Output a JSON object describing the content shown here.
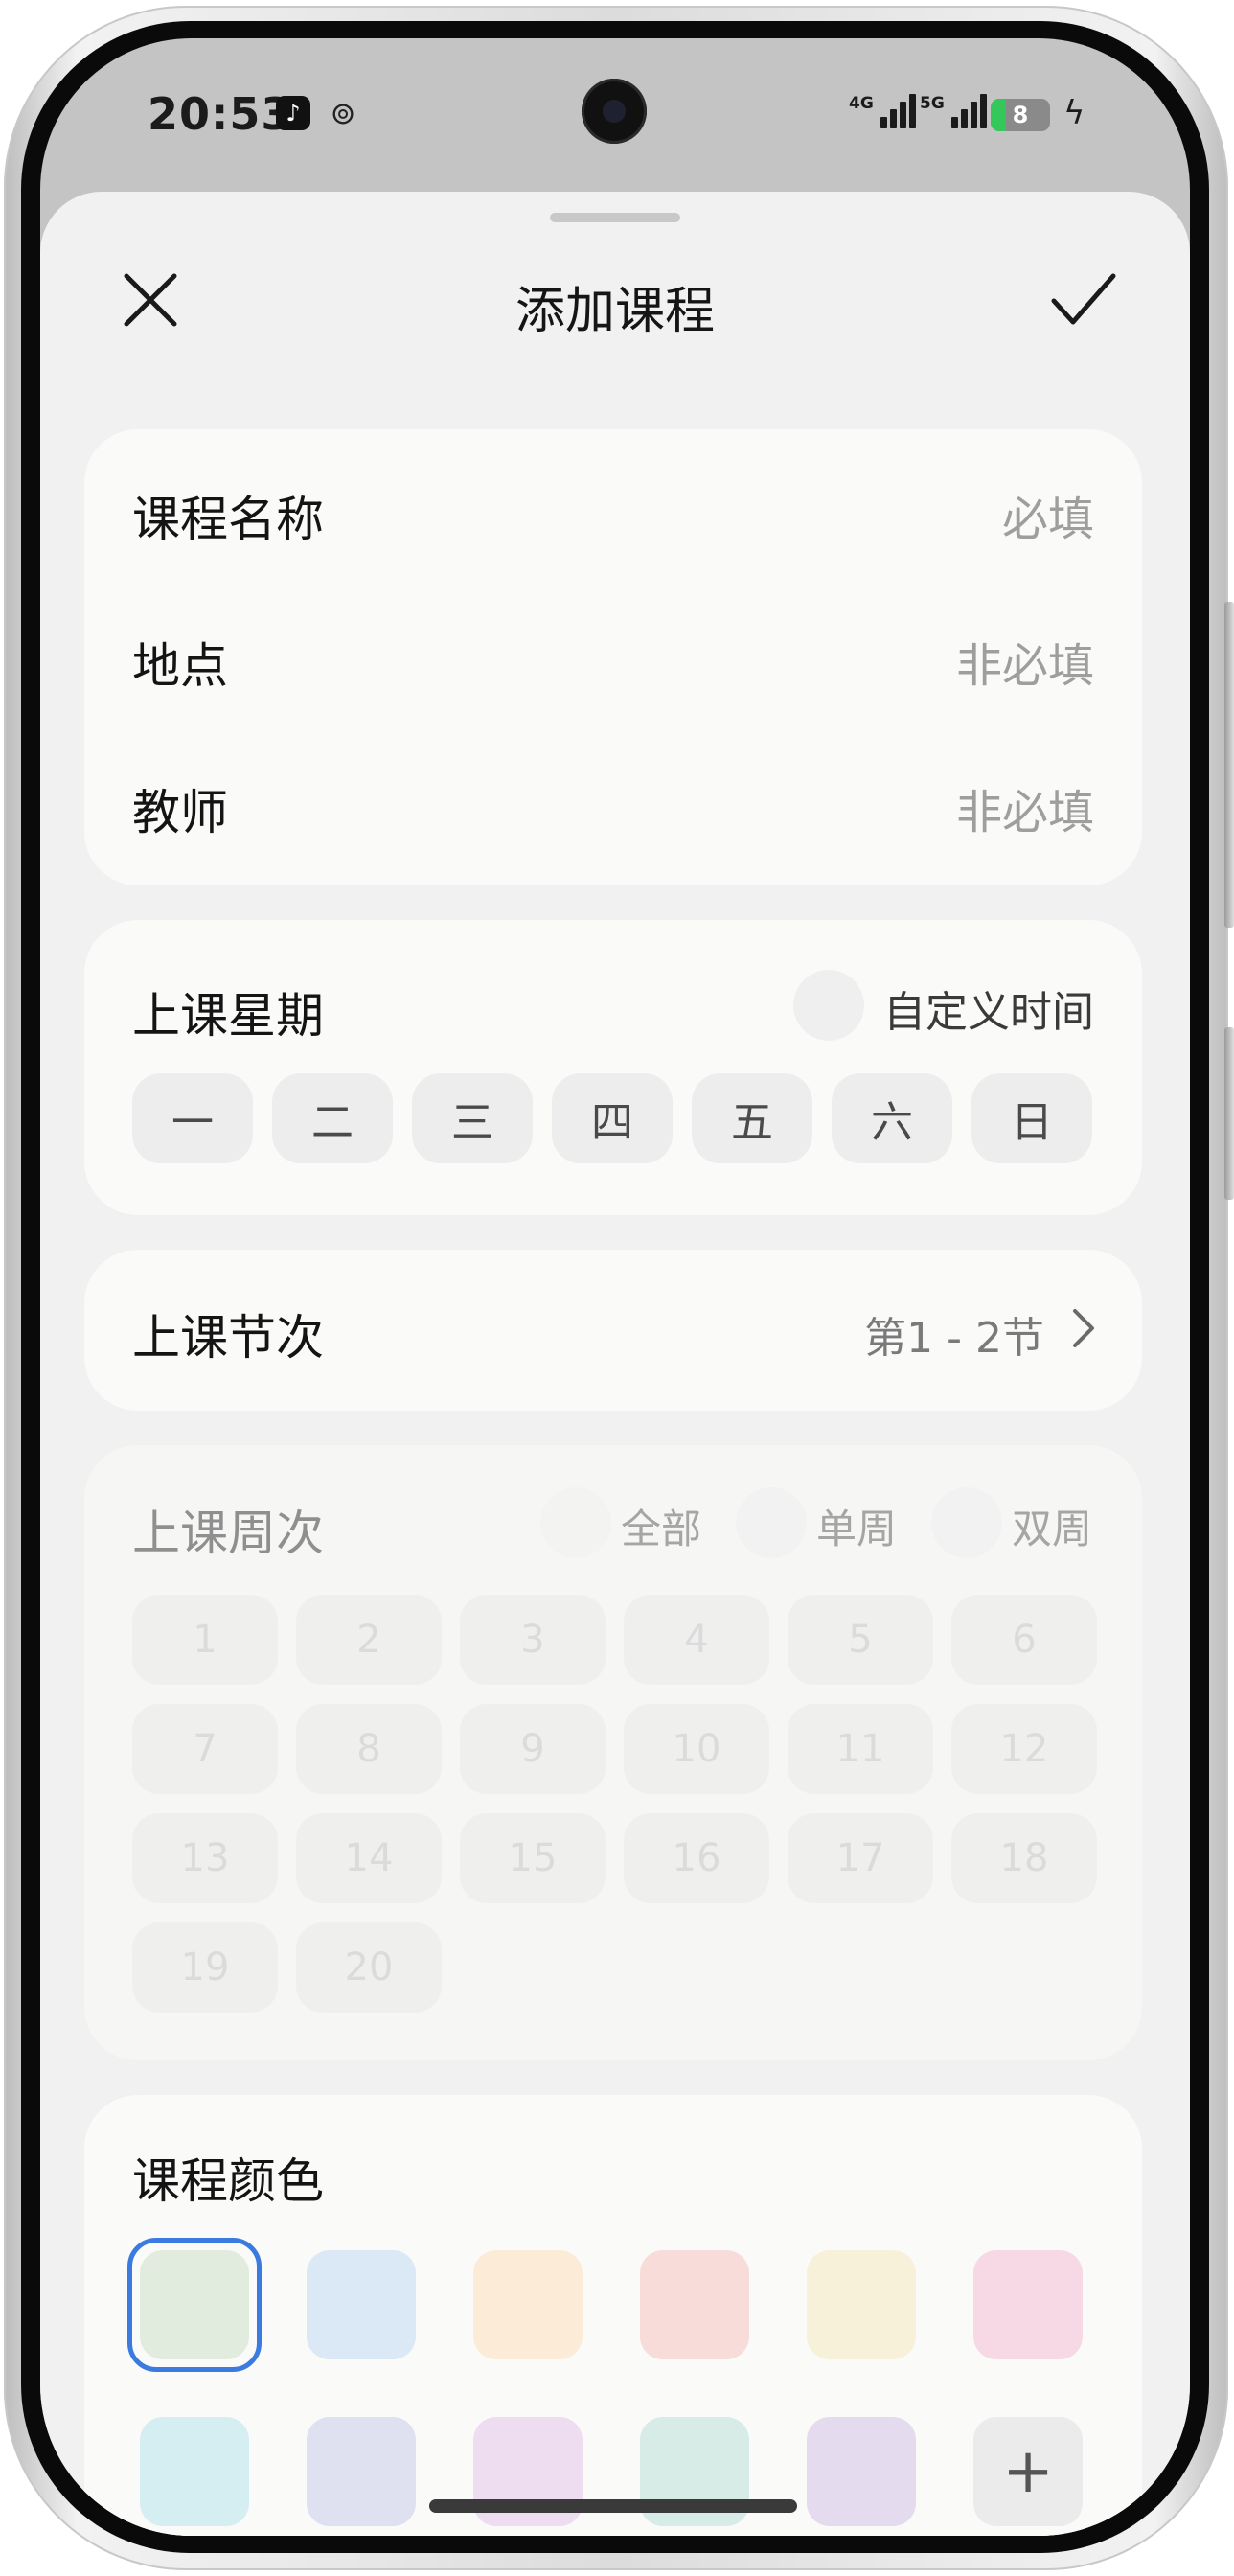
{
  "status_bar": {
    "time": "20:53",
    "battery_level": "8",
    "network_1": "4G",
    "network_2": "5G"
  },
  "header": {
    "title": "添加课程",
    "close_icon": "close-icon",
    "confirm_icon": "check-icon"
  },
  "info_card": {
    "rows": [
      {
        "label": "课程名称",
        "placeholder": "必填"
      },
      {
        "label": "地点",
        "placeholder": "非必填"
      },
      {
        "label": "教师",
        "placeholder": "非必填"
      }
    ]
  },
  "weekday_card": {
    "label": "上课星期",
    "custom_time_label": "自定义时间",
    "days": [
      "一",
      "二",
      "三",
      "四",
      "五",
      "六",
      "日"
    ]
  },
  "section_card": {
    "label": "上课节次",
    "value": "第1 - 2节"
  },
  "week_card": {
    "label": "上课周次",
    "options": [
      "全部",
      "单周",
      "双周"
    ],
    "weeks": [
      "1",
      "2",
      "3",
      "4",
      "5",
      "6",
      "7",
      "8",
      "9",
      "10",
      "11",
      "12",
      "13",
      "14",
      "15",
      "16",
      "17",
      "18",
      "19",
      "20"
    ]
  },
  "color_card": {
    "label": "课程颜色",
    "colors": [
      "#e1ecdf",
      "#dae9f5",
      "#fcebd6",
      "#f8dcd9",
      "#f8f1da",
      "#f7d9e5",
      "#d5eef2",
      "#dfe0f0",
      "#eedcf0",
      "#d7ebe7",
      "#e4dcee"
    ],
    "selected_index": 0,
    "add_icon": "plus-icon"
  }
}
